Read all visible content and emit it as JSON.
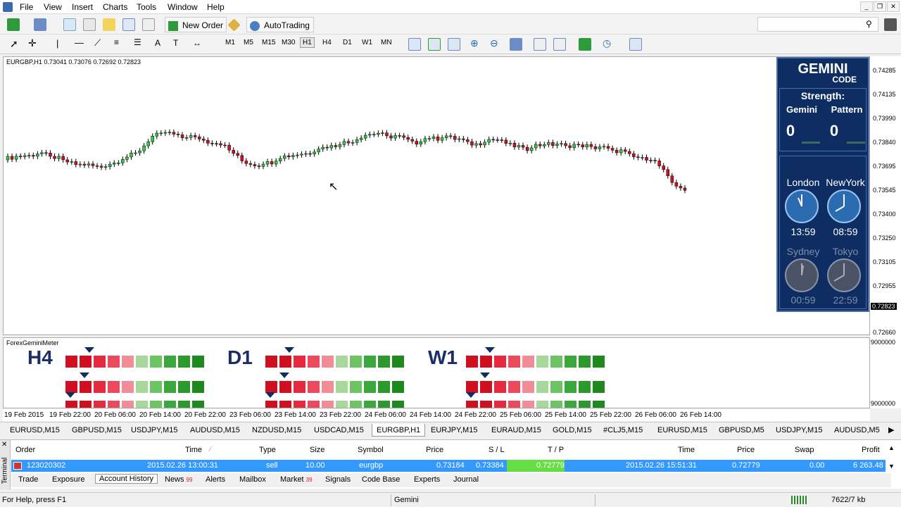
{
  "menu": [
    "File",
    "View",
    "Insert",
    "Charts",
    "Tools",
    "Window",
    "Help"
  ],
  "toolbar": {
    "new_order": "New Order",
    "autotrading": "AutoTrading"
  },
  "timeframes": [
    "M1",
    "M5",
    "M15",
    "M30",
    "H1",
    "H4",
    "D1",
    "W1",
    "MN"
  ],
  "chart": {
    "header": "EURGBP,H1  0.73041 0.73076 0.72692 0.72823",
    "price_labels": [
      "0.74285",
      "0.74135",
      "0.73990",
      "0.73840",
      "0.73695",
      "0.73545",
      "0.73400",
      "0.73250",
      "0.73105",
      "0.72955",
      "0.72823",
      "0.72660"
    ],
    "current_price": "0.72823",
    "indicator_title": "ForexGeminiMeter",
    "indicator_scale_top": "9000000",
    "indicator_scale_bottom": "9000000",
    "time_labels": [
      "19 Feb 2015",
      "19 Feb 22:00",
      "20 Feb 06:00",
      "20 Feb 14:00",
      "20 Feb 22:00",
      "23 Feb 06:00",
      "23 Feb 14:00",
      "23 Feb 22:00",
      "24 Feb 06:00",
      "24 Feb 14:00",
      "24 Feb 22:00",
      "25 Feb 06:00",
      "25 Feb 14:00",
      "25 Feb 22:00",
      "26 Feb 06:00",
      "26 Feb 14:00"
    ],
    "meters": [
      "H4",
      "D1",
      "W1"
    ]
  },
  "gemini": {
    "title": "GEMINI",
    "subtitle": "CODE",
    "strength": "Strength:",
    "col1": "Gemini",
    "col2": "Pattern",
    "val1": "0",
    "val2": "0",
    "city1": "London",
    "city2": "NewYork",
    "time1": "13:59",
    "time2": "08:59",
    "city3": "Sydney",
    "city4": "Tokyo",
    "time3": "00:59",
    "time4": "22:59"
  },
  "chart_tabs": [
    "EURUSD,M15",
    "GBPUSD,M15",
    "USDJPY,M15",
    "AUDUSD,M15",
    "NZDUSD,M15",
    "USDCAD,M15",
    "EURGBP,H1",
    "EURJPY,M15",
    "EURAUD,M15",
    "GOLD,M15",
    "#CLJ5,M15",
    "EURUSD,M15",
    "GBPUSD,M5",
    "USDJPY,M15",
    "AUDUSD,M5"
  ],
  "terminal": {
    "headers": [
      "Order",
      "Time",
      "Type",
      "Size",
      "Symbol",
      "Price",
      "S / L",
      "T / P",
      "Time",
      "Price",
      "Swap",
      "Profit"
    ],
    "row": [
      "123020302",
      "2015.02.26 13:00:31",
      "sell",
      "10.00",
      "eurgbp",
      "0.73184",
      "0.73384",
      "0.72779",
      "2015.02.26 15:51:31",
      "0.72779",
      "0.00",
      "6 263.48"
    ],
    "side_label": "Terminal"
  },
  "terminal_tabs": [
    {
      "label": "Trade",
      "badge": ""
    },
    {
      "label": "Exposure",
      "badge": ""
    },
    {
      "label": "Account History",
      "badge": ""
    },
    {
      "label": "News",
      "badge": "99"
    },
    {
      "label": "Alerts",
      "badge": ""
    },
    {
      "label": "Mailbox",
      "badge": ""
    },
    {
      "label": "Market",
      "badge": "39"
    },
    {
      "label": "Signals",
      "badge": ""
    },
    {
      "label": "Code Base",
      "badge": ""
    },
    {
      "label": "Experts",
      "badge": ""
    },
    {
      "label": "Journal",
      "badge": ""
    }
  ],
  "status": {
    "help": "For Help, press F1",
    "profile": "Gemini",
    "traffic": "7622/7 kb"
  }
}
